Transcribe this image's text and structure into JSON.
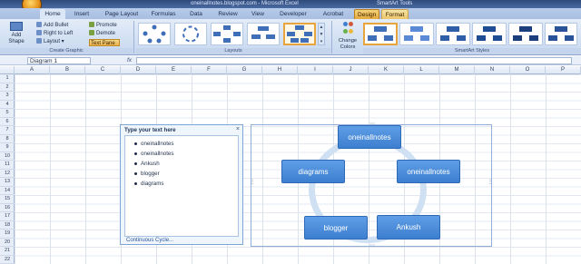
{
  "window": {
    "title_left": "oneinallnotes.blogspot.com - Microsoft Excel",
    "title_right": "SmartArt Tools"
  },
  "tabs": [
    {
      "label": "Home"
    },
    {
      "label": "Insert"
    },
    {
      "label": "Page Layout"
    },
    {
      "label": "Formulas"
    },
    {
      "label": "Data"
    },
    {
      "label": "Review"
    },
    {
      "label": "View"
    },
    {
      "label": "Developer"
    },
    {
      "label": "Acrobat"
    },
    {
      "label": "Design"
    },
    {
      "label": "Format"
    }
  ],
  "ribbon": {
    "create_graphic": {
      "add_shape": "Add Shape",
      "add_bullet": "Add Bullet",
      "right_to_left": "Right to Left",
      "layout": "Layout",
      "promote": "Promote",
      "demote": "Demote",
      "text_pane": "Text Pane",
      "group_label": "Create Graphic"
    },
    "layouts_label": "Layouts",
    "change_colors": "Change Colors",
    "smartart_styles_label": "SmartArt Styles"
  },
  "formula_bar": {
    "name_box": "Diagram 1",
    "fx": "fx",
    "content": ""
  },
  "columns": [
    "A",
    "B",
    "C",
    "D",
    "E",
    "F",
    "G",
    "H",
    "I",
    "J",
    "K",
    "L",
    "M",
    "N",
    "O",
    "P"
  ],
  "rows": [
    "1",
    "2",
    "3",
    "4",
    "5",
    "6",
    "7",
    "8",
    "9",
    "10",
    "11",
    "12",
    "13",
    "14",
    "15",
    "16",
    "17",
    "18",
    "19",
    "20",
    "21",
    "22"
  ],
  "text_pane": {
    "title": "Type your text here",
    "items": [
      "oneinallnotes",
      "oneinallnotes",
      "Ankush",
      "blogger",
      "diagrams"
    ],
    "footer": "Continuous Cycle..."
  },
  "smartart": {
    "nodes": [
      "oneinallnotes",
      "oneinallnotes",
      "Ankush",
      "blogger",
      "diagrams"
    ],
    "colors": {
      "node": "#4a8ad8",
      "ring": "#cfe0f3",
      "accent": "#e8a53d"
    }
  }
}
